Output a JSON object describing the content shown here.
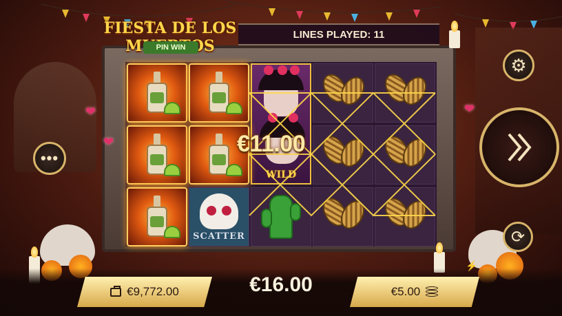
{
  "game": {
    "logo_title": "FIESTA DE LOS MUERTOS",
    "logo_subtitle": "PIN WIN"
  },
  "status": {
    "lines_played": "LINES PLAYED: 11"
  },
  "reels": {
    "line_win": "€11.00",
    "symbols": [
      [
        "tequila",
        "tequila",
        "wild",
        "maracas",
        "maracas"
      ],
      [
        "tequila",
        "tequila",
        "wild",
        "maracas",
        "maracas"
      ],
      [
        "tequila",
        "scatter",
        "cactus",
        "maracas",
        "maracas"
      ]
    ],
    "wild_label": "WILD",
    "scatter_label": "SCATTER"
  },
  "bottom": {
    "balance": "€9,772.00",
    "win": "€16.00",
    "bet": "€5.00"
  },
  "icons": {
    "settings": "gear-icon",
    "menu": "more-icon",
    "spin": "spin-chevrons-icon",
    "autoplay": "autoplay-icon",
    "wallet": "wallet-icon",
    "coins": "coins-icon",
    "turbo": "lightning-icon"
  },
  "colors": {
    "gold": "#ffd64a",
    "win_line": "#ffd84a",
    "panel": "#e8c070"
  }
}
